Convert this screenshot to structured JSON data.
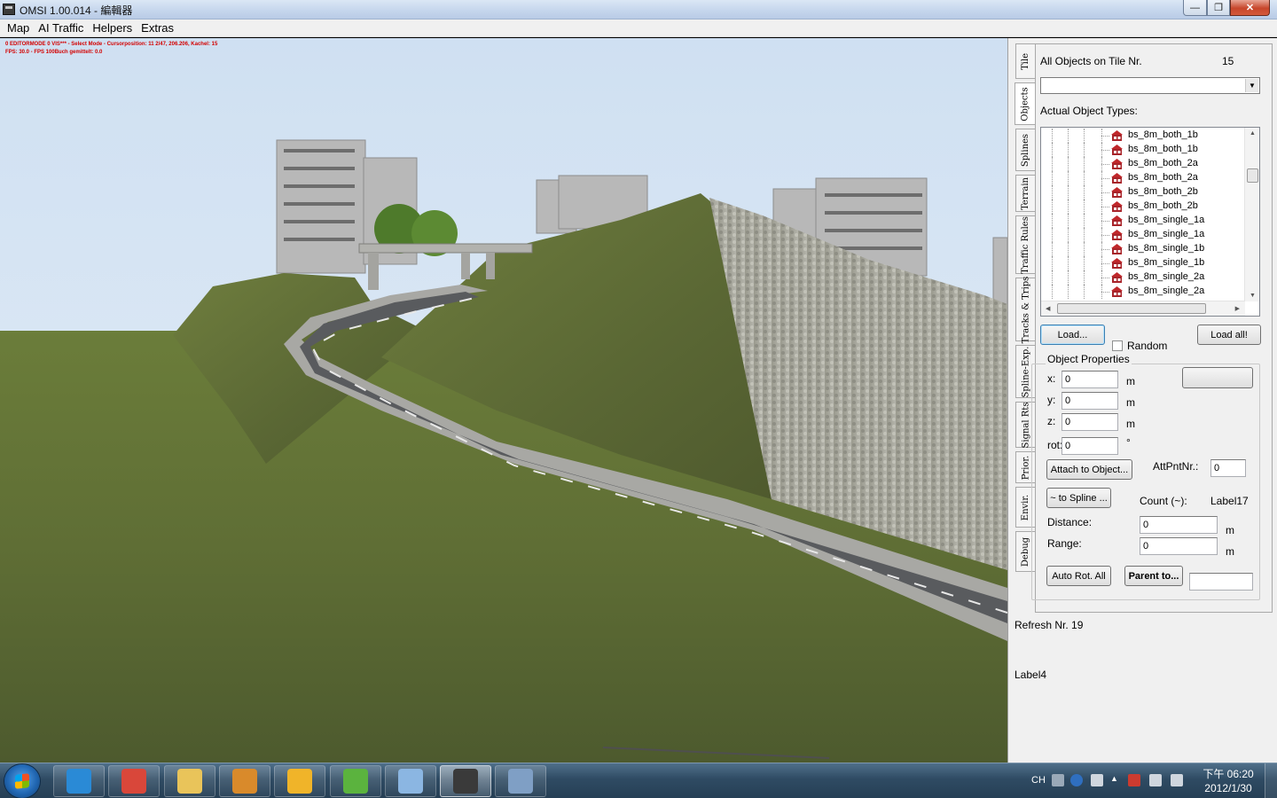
{
  "window": {
    "title": "OMSI 1.00.014 - 編輯器",
    "minimize_label": "—",
    "maximize_label": "❐",
    "close_label": "✕"
  },
  "menu": [
    "Map",
    "AI Traffic",
    "Helpers",
    "Extras"
  ],
  "viewport": {
    "debug_line_1": "0 EDITORMODE 0 VIS*** - Select Mode - Cursorposition: 11 2/47, 206.206, Kachel: 15",
    "debug_line_2": "FPS: 30.0 - FPS 100Buch gemittelt: 0.0"
  },
  "panel": {
    "tabs": [
      {
        "label": "Tile",
        "active": false
      },
      {
        "label": "Objects",
        "active": true
      },
      {
        "label": "Splines",
        "active": false
      },
      {
        "label": "Terrain",
        "active": false
      },
      {
        "label": "Traffic Rules",
        "active": false
      },
      {
        "label": "Tracks & Trips",
        "active": false
      },
      {
        "label": "Spline-Exp.",
        "active": false
      },
      {
        "label": "Signal Rts",
        "active": false
      },
      {
        "label": "Prior.",
        "active": false
      },
      {
        "label": "Envir.",
        "active": false
      },
      {
        "label": "Debug",
        "active": false
      }
    ],
    "all_objects_label": "All Objects on Tile Nr.",
    "tile_number": "15",
    "combo_value": "",
    "actual_types_label": "Actual Object Types:",
    "object_types": [
      "bs_8m_both_1b",
      "bs_8m_both_1b",
      "bs_8m_both_2a",
      "bs_8m_both_2a",
      "bs_8m_both_2b",
      "bs_8m_both_2b",
      "bs_8m_single_1a",
      "bs_8m_single_1a",
      "bs_8m_single_1b",
      "bs_8m_single_1b",
      "bs_8m_single_2a",
      "bs_8m_single_2a"
    ],
    "load_button": "Load...",
    "random_label": "Random",
    "random_checked": false,
    "load_all_button": "Load all!",
    "object_properties_caption": "Object Properties",
    "x_label": "x:",
    "x_value": "0",
    "x_unit": "m",
    "y_label": "y:",
    "y_value": "0",
    "y_unit": "m",
    "z_label": "z:",
    "z_value": "0",
    "z_unit": "m",
    "rot_label": "rot:",
    "rot_value": "0",
    "rot_unit": "°",
    "side_button": "",
    "attach_button": "Attach to Object...",
    "attpnt_label": "AttPntNr.:",
    "attpnt_value": "0",
    "to_spline_button": "~ to Spline ...",
    "count_label": "Count (~):",
    "count_value": "Label17",
    "distance_label": "Distance:",
    "distance_value": "0",
    "distance_unit": "m",
    "range_label": "Range:",
    "range_value": "0",
    "range_unit": "m",
    "auto_rot_button": "Auto Rot. All",
    "parent_button": "Parent to...",
    "parent_value": "",
    "refresh_label": "Refresh Nr. 19",
    "label4": "Label4"
  },
  "taskbar": {
    "apps": [
      {
        "name": "internet-explorer-icon",
        "color": "#2a8ad6"
      },
      {
        "name": "chrome-icon",
        "color": "#d9473a"
      },
      {
        "name": "file-explorer-icon",
        "color": "#e9c45a"
      },
      {
        "name": "media-player-icon",
        "color": "#d98a2b"
      },
      {
        "name": "qq-icon",
        "color": "#f0b429"
      },
      {
        "name": "messenger-icon",
        "color": "#5bb33e"
      },
      {
        "name": "paint-icon",
        "color": "#8bb6e2"
      },
      {
        "name": "omsi-editor-icon",
        "color": "#3a3a3a"
      },
      {
        "name": "calculator-icon",
        "color": "#7f9fc5"
      }
    ],
    "active_app": "omsi-editor-icon",
    "tray": {
      "language": "CH",
      "time": "下午 06:20",
      "date": "2012/1/30"
    }
  }
}
